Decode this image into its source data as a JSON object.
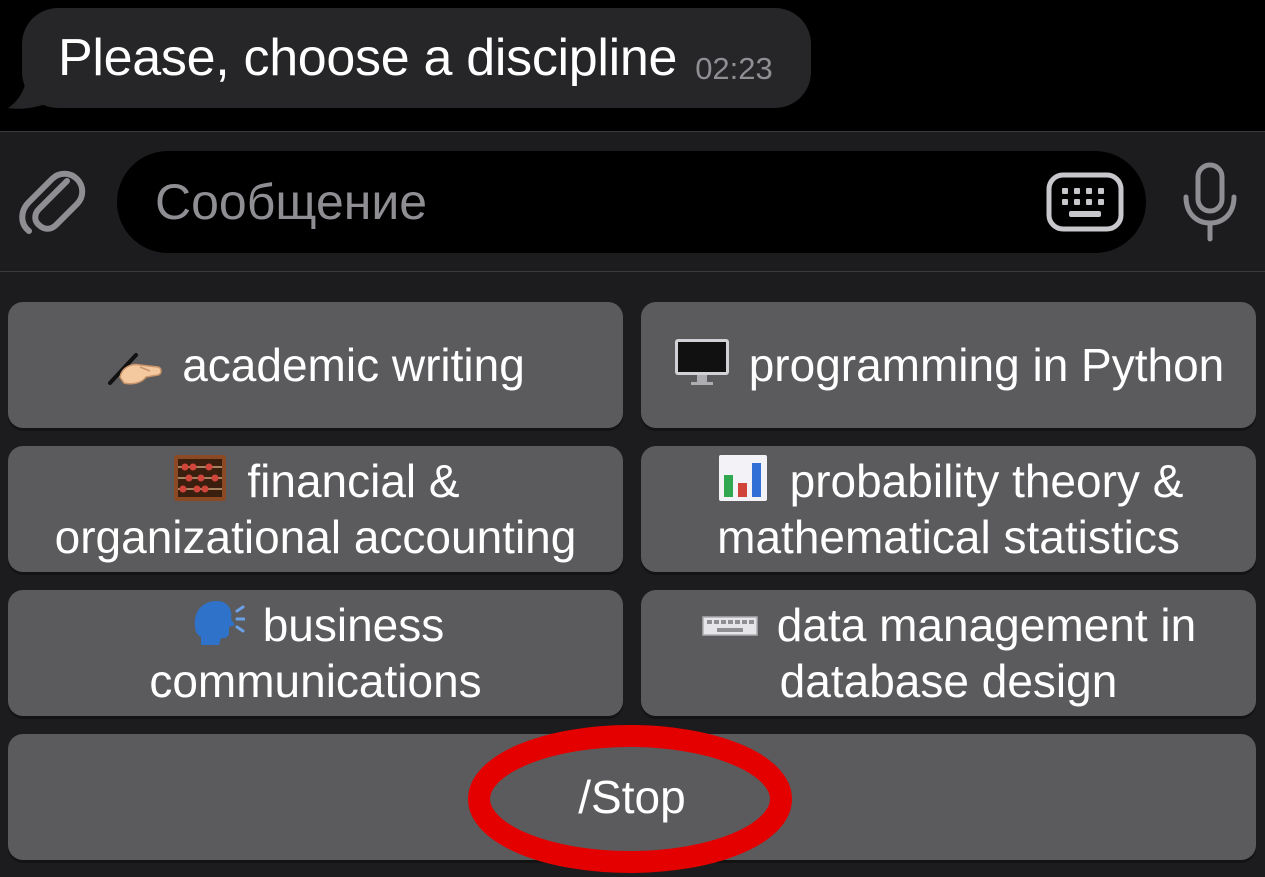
{
  "chat": {
    "message_text": "Please, choose a discipline",
    "message_time": "02:23"
  },
  "composer": {
    "placeholder": "Сообщение",
    "attach_icon": "paperclip-icon",
    "keyboard_icon": "keyboard-icon",
    "mic_icon": "microphone-icon"
  },
  "keyboard": {
    "buttons": [
      {
        "emoji": "writing-hand-icon",
        "label_line1": "academic writing",
        "label_line2": ""
      },
      {
        "emoji": "desktop-computer-icon",
        "label_line1": "programming in Python",
        "label_line2": ""
      },
      {
        "emoji": "abacus-icon",
        "label_line1": "financial &",
        "label_line2": "organizational accounting"
      },
      {
        "emoji": "bar-chart-icon",
        "label_line1": "probability theory &",
        "label_line2": "mathematical statistics"
      },
      {
        "emoji": "speaking-head-icon",
        "label_line1": "business",
        "label_line2": "communications"
      },
      {
        "emoji": "keyboard-icon",
        "label_line1": "data management in",
        "label_line2": "database design"
      }
    ],
    "stop_label": "/Stop"
  },
  "colors": {
    "background": "#000000",
    "bubble": "#262628",
    "panel": "#1c1c1e",
    "button": "#5b5b5d",
    "annotation_ring": "#e50000"
  }
}
